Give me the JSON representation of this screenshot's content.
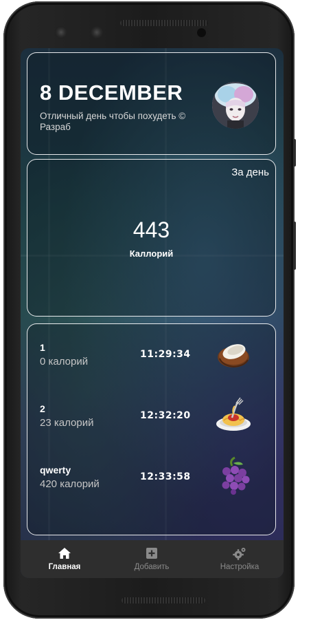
{
  "header": {
    "date": "8 DECEMBER",
    "motto": "Отличный день чтобы похудеть © Разраб"
  },
  "summary": {
    "period_label": "За день",
    "calories_value": "443",
    "calories_label": "Каллорий"
  },
  "meals": [
    {
      "name": "1",
      "calories": "0 калорий",
      "time": "11:29:34",
      "icon": "coconut-icon"
    },
    {
      "name": "2",
      "calories": "23 калорий",
      "time": "12:32:20",
      "icon": "spaghetti-icon"
    },
    {
      "name": "qwerty",
      "calories": "420 калорий",
      "time": "12:33:58",
      "icon": "grapes-icon"
    }
  ],
  "nav": {
    "home": {
      "label": "Главная",
      "icon": "home-icon",
      "active": true
    },
    "add": {
      "label": "Добавить",
      "icon": "add-box-icon",
      "active": false
    },
    "settings": {
      "label": "Настройка",
      "icon": "settings-gear-icon",
      "active": false
    }
  },
  "colors": {
    "nav_active": "#ffffff",
    "nav_inactive": "#8a8a8a",
    "card_border": "#ffffff",
    "navbar_bg": "#2e2e2e"
  }
}
